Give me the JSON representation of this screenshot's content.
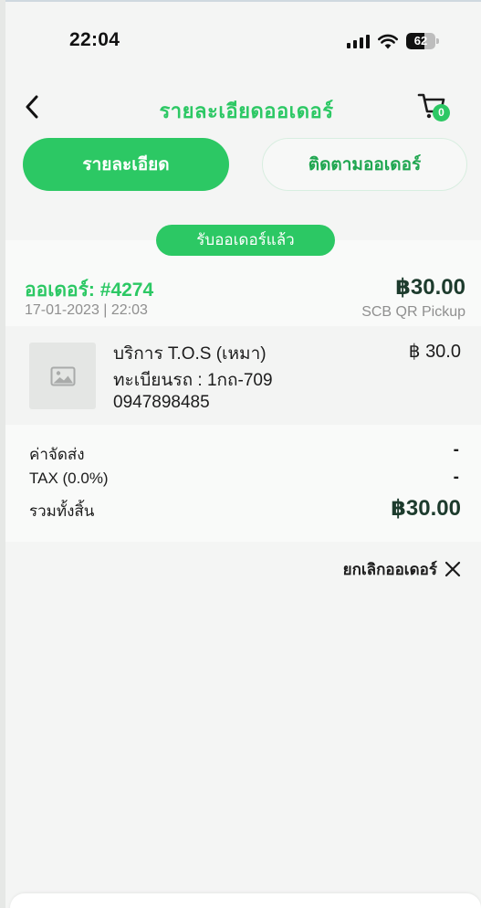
{
  "status_bar": {
    "time": "22:04",
    "battery": "62"
  },
  "header": {
    "title": "รายละเอียดออเดอร์",
    "cart_count": "0"
  },
  "tabs": {
    "details": "รายละเอียด",
    "track": "ติดตามออเดอร์"
  },
  "order": {
    "status": "รับออเดอร์แล้ว",
    "number": "ออเดอร์: #4274",
    "datetime": "17-01-2023 | 22:03",
    "total": "฿30.00",
    "payment_method": "SCB QR Pickup"
  },
  "item": {
    "name": "บริการ T.O.S (เหมา)",
    "plate": "ทะเบียนรถ : 1กถ-709",
    "phone": "0947898485",
    "price": "฿ 30.0"
  },
  "summary": {
    "shipping_label": "ค่าจัดส่ง",
    "shipping_value": "-",
    "tax_label": "TAX (0.0%)",
    "tax_value": "-",
    "total_label": "รวมทั้งสิ้น",
    "total_value": "฿30.00"
  },
  "actions": {
    "cancel_label": "ยกเลิกออเดอร์"
  },
  "colors": {
    "accent": "#2cc864",
    "dark_text": "#1d3b2d",
    "muted_text": "#8f8f8f"
  }
}
